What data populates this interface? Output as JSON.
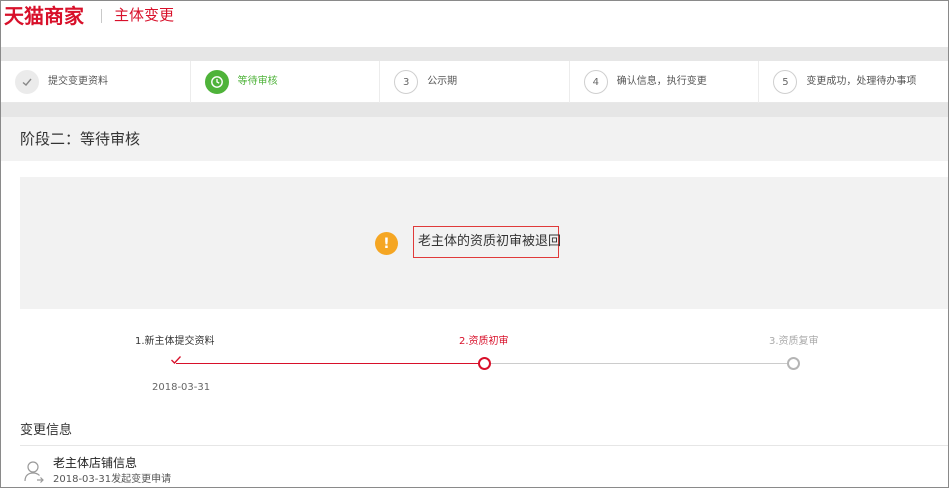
{
  "header": {
    "logo": "天猫商家",
    "title": "主体变更"
  },
  "steps": [
    {
      "number": "✓",
      "label": "提交变更资料",
      "state": "done"
    },
    {
      "number": "◷",
      "label": "等待审核",
      "state": "active"
    },
    {
      "number": "3",
      "label": "公示期",
      "state": "pending"
    },
    {
      "number": "4",
      "label": "确认信息，执行变更",
      "state": "pending"
    },
    {
      "number": "5",
      "label": "变更成功，处理待办事项",
      "state": "pending"
    }
  ],
  "stage": {
    "title": "阶段二：等待审核"
  },
  "status": {
    "icon": "exclamation-icon",
    "message": "老主体的资质初审被退回"
  },
  "timeline": {
    "nodes": [
      {
        "label": "1.新主体提交资料",
        "date": "2018-03-31",
        "state": "done"
      },
      {
        "label": "2.资质初审",
        "state": "current"
      },
      {
        "label": "3.资质复审",
        "state": "pending"
      }
    ]
  },
  "change_info": {
    "title": "变更信息",
    "item": {
      "name": "老主体店铺信息",
      "sub": "2018-03-31发起变更申请"
    }
  },
  "colors": {
    "brand_red": "#d8102a",
    "active_green": "#4fb33a",
    "warning_orange": "#f5a623"
  }
}
